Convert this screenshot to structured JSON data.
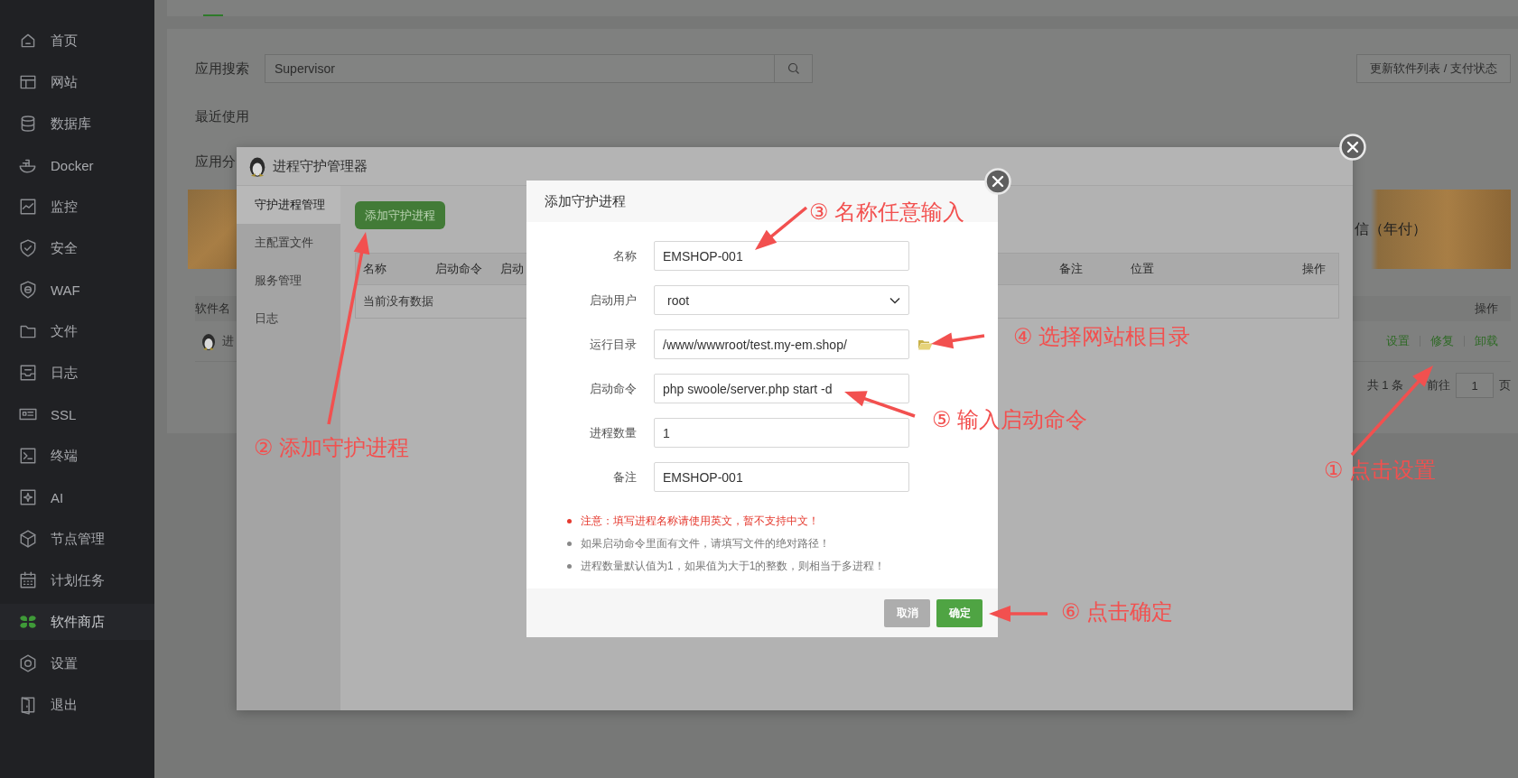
{
  "sidebar": {
    "items": [
      {
        "label": "首页",
        "selected": false
      },
      {
        "label": "网站",
        "selected": false
      },
      {
        "label": "数据库",
        "selected": false
      },
      {
        "label": "Docker",
        "selected": false
      },
      {
        "label": "监控",
        "selected": false
      },
      {
        "label": "安全",
        "selected": false
      },
      {
        "label": "WAF",
        "selected": false
      },
      {
        "label": "文件",
        "selected": false
      },
      {
        "label": "日志",
        "selected": false
      },
      {
        "label": "SSL",
        "selected": false
      },
      {
        "label": "终端",
        "selected": false
      },
      {
        "label": "AI",
        "selected": false
      },
      {
        "label": "节点管理",
        "selected": false
      },
      {
        "label": "计划任务",
        "selected": false
      },
      {
        "label": "软件商店",
        "selected": true
      },
      {
        "label": "设置",
        "selected": false
      },
      {
        "label": "退出",
        "selected": false
      }
    ]
  },
  "store": {
    "search_label": "应用搜索",
    "search_value": "Supervisor",
    "update_button": "更新软件列表 / 支付状态",
    "recent_label": "最近使用",
    "category_label": "应用分",
    "banner_text": "信（年付）",
    "table": {
      "columns": [
        "软件名",
        "操作"
      ],
      "rows": [
        {
          "name": "进",
          "actions": [
            "设置",
            "修复",
            "卸载"
          ]
        }
      ]
    },
    "pagination": {
      "total": "共 1 条",
      "goto_label": "前往",
      "page": "1",
      "page_suffix": "页"
    }
  },
  "manager": {
    "title": "进程守护管理器",
    "nav": [
      {
        "label": "守护进程管理",
        "selected": true
      },
      {
        "label": "主配置文件",
        "selected": false
      },
      {
        "label": "服务管理",
        "selected": false
      },
      {
        "label": "日志",
        "selected": false
      }
    ],
    "add_button": "添加守护进程",
    "table": {
      "columns": [
        "名称",
        "启动命令",
        "启动",
        "备注",
        "位置",
        "操作"
      ],
      "empty_text": "当前没有数据"
    }
  },
  "dialog": {
    "title": "添加守护进程",
    "fields": [
      {
        "label": "名称",
        "kind": "text",
        "value": "EMSHOP-001"
      },
      {
        "label": "启动用户",
        "kind": "select",
        "value": "root"
      },
      {
        "label": "运行目录",
        "kind": "folder",
        "value": "/www/wwwroot/test.my-em.shop/"
      },
      {
        "label": "启动命令",
        "kind": "text",
        "value": "php swoole/server.php start -d"
      },
      {
        "label": "进程数量",
        "kind": "text",
        "value": "1"
      },
      {
        "label": "备注",
        "kind": "text",
        "value": "EMSHOP-001"
      }
    ],
    "notes": [
      {
        "kind": "warning",
        "text": "注意：填写进程名称请使用英文，暂不支持中文！"
      },
      {
        "kind": "info",
        "text": "如果启动命令里面有文件，请填写文件的绝对路径！"
      },
      {
        "kind": "info",
        "text": "进程数量默认值为1，如果值为大于1的整数，则相当于多进程！"
      }
    ],
    "buttons": [
      {
        "label": "取消",
        "kind": "cancel"
      },
      {
        "label": "确定",
        "kind": "primary"
      }
    ]
  },
  "annotations": [
    {
      "text": "③ 名称任意输入"
    },
    {
      "text": "④ 选择网站根目录"
    },
    {
      "text": "⑤ 输入启动命令"
    },
    {
      "text": "② 添加守护进程"
    },
    {
      "text": "① 点击设置"
    },
    {
      "text": "⑥ 点击确定"
    }
  ]
}
